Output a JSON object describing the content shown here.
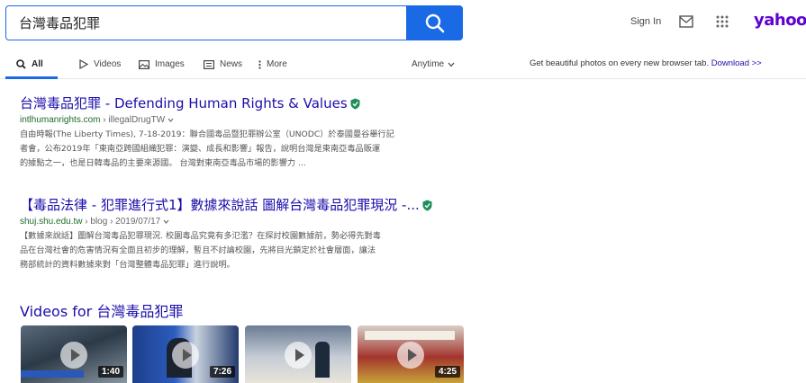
{
  "search": {
    "query": "台灣毒品犯罪"
  },
  "header": {
    "signin": "Sign In",
    "logo": "yahoo!"
  },
  "tabs": [
    {
      "label": "All",
      "icon": "search-icon"
    },
    {
      "label": "Videos",
      "icon": "play-icon"
    },
    {
      "label": "Images",
      "icon": "image-icon"
    },
    {
      "label": "News",
      "icon": "news-icon"
    },
    {
      "label": "More",
      "icon": "more-icon"
    }
  ],
  "anytime": "Anytime",
  "promo": {
    "text": "Get beautiful photos on every new browser tab.",
    "link": "Download >>"
  },
  "results": [
    {
      "title": "台灣毒品犯罪 - Defending Human Rights & Values",
      "domain": "intlhumanrights.com",
      "crumb": "› illegalDrugTW",
      "desc1": "自由時報(The Liberty Times), 7-18-2019：聯合國毒品暨犯罪辦公室（UNODC）於泰國曼谷舉行記",
      "desc2": "者會，公布2019年「東南亞跨國組織犯罪：演變、成長和影響」報告，說明台灣是東南亞毒品販運",
      "desc3": "的據點之一，也是日韓毒品的主要來源國。 台灣對東南亞毒品市場的影響力 ..."
    },
    {
      "title": "【毒品法律 - 犯罪進行式1】數據來說話 圖解台灣毒品犯罪現況 -...",
      "domain": "shuj.shu.edu.tw",
      "crumb": "› blog › 2019/07/17",
      "desc1": "【數據來說話】圖解台灣毒品犯罪現況. 校園毒品究竟有多氾濫？在探討校園數據前，勢必得先對毒",
      "desc2": "品在台灣社會的危害情況有全面且初步的理解，暫且不討論校園，先將目光鎖定於社會層面，讓法",
      "desc3": "務部統計的資料數據來對「台灣整體毒品犯罪」進行說明。"
    }
  ],
  "videos": {
    "heading": "Videos for 台灣毒品犯罪",
    "items": [
      {
        "duration": "1:40"
      },
      {
        "duration": "7:26"
      },
      {
        "duration": ""
      },
      {
        "duration": "4:25"
      }
    ]
  },
  "colors": {
    "accent": "#1a6ae6",
    "link": "#1a0dab",
    "url": "#1e6b2a",
    "logo": "#6001d2",
    "verified": "#1e8e5a"
  }
}
